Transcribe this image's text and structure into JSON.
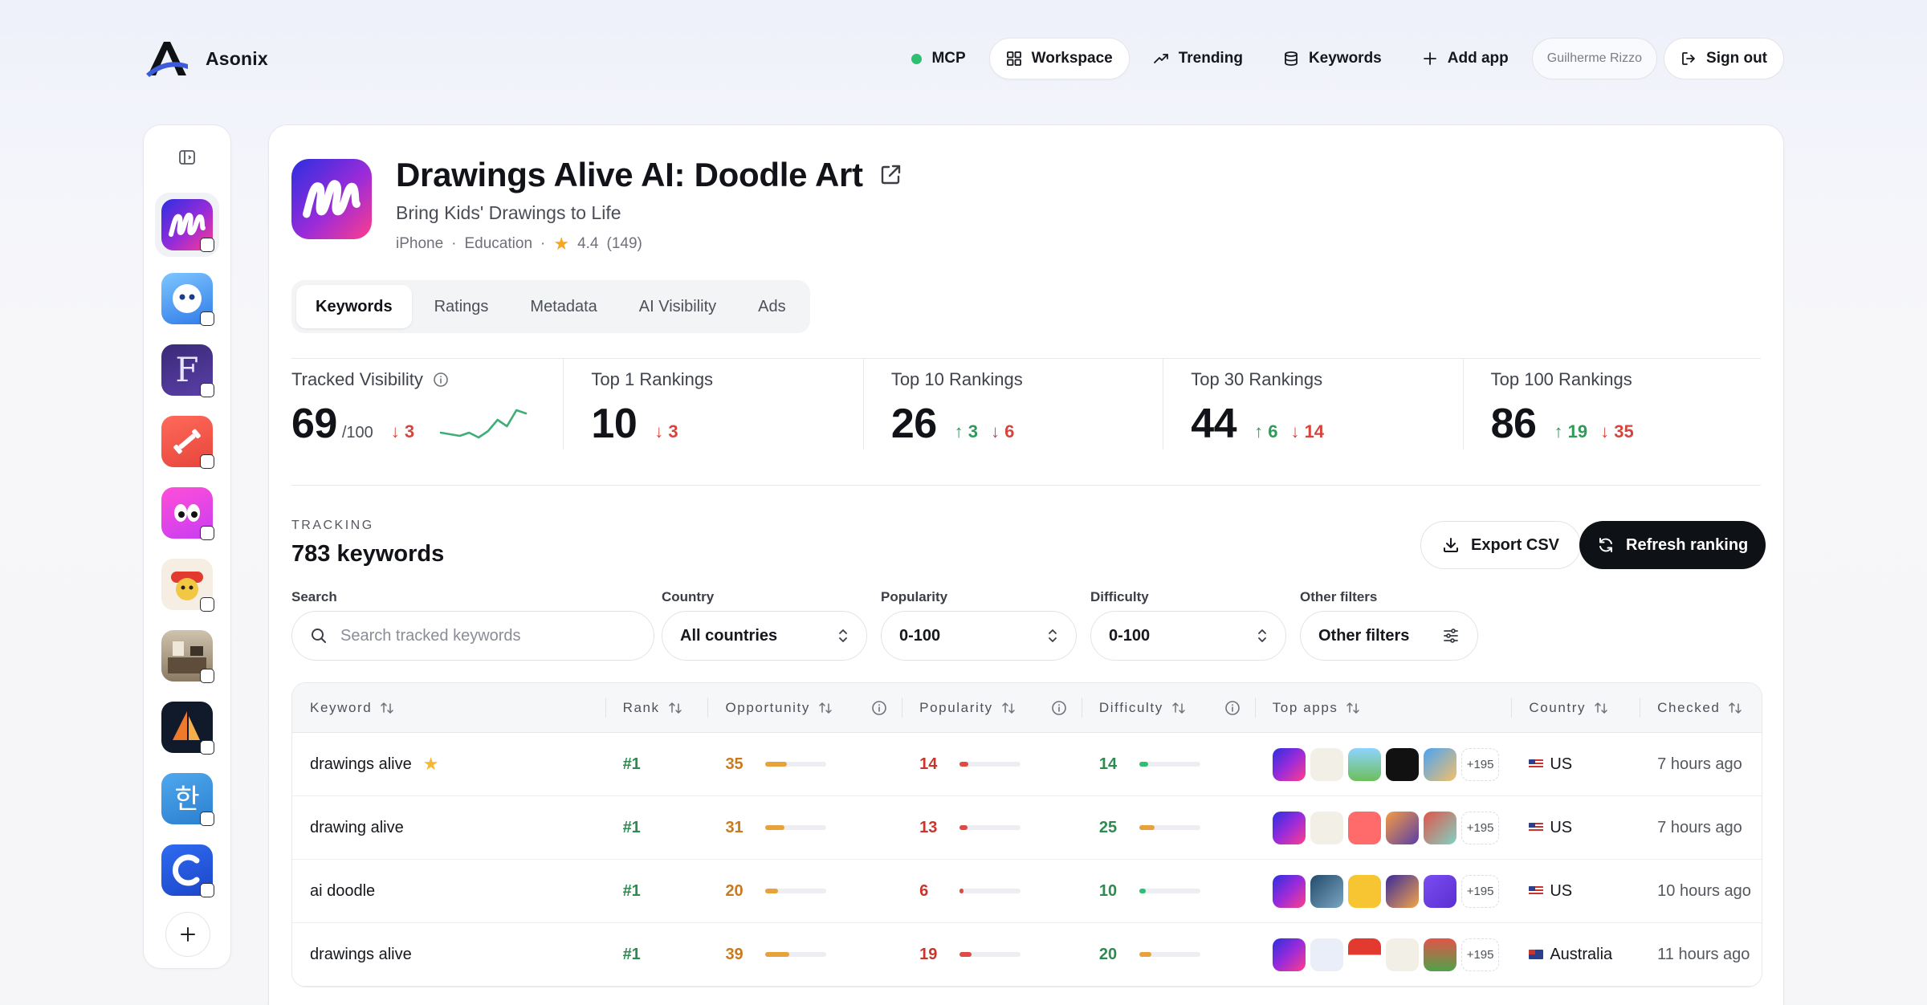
{
  "brand": {
    "name": "Asonix"
  },
  "nav": {
    "mcp": "MCP",
    "workspace": "Workspace",
    "trending": "Trending",
    "keywords": "Keywords",
    "add_app": "Add app",
    "user": "Guilherme Rizzo",
    "sign_out": "Sign out"
  },
  "app": {
    "title": "Drawings Alive AI: Doodle Art",
    "subtitle": "Bring Kids' Drawings to Life",
    "platform": "iPhone",
    "category": "Education",
    "rating": "4.4",
    "rating_count": "(149)"
  },
  "tabs": [
    "Keywords",
    "Ratings",
    "Metadata",
    "AI Visibility",
    "Ads"
  ],
  "stats": {
    "visibility": {
      "label": "Tracked Visibility",
      "value": "69",
      "unit": "/100",
      "delta_down": "3",
      "sparkline": [
        8,
        7,
        6,
        8,
        5,
        9,
        16,
        12,
        22,
        20
      ]
    },
    "top1": {
      "label": "Top 1 Rankings",
      "value": "10",
      "delta_down": "3"
    },
    "top10": {
      "label": "Top 10 Rankings",
      "value": "26",
      "delta_up": "3",
      "delta_down": "6"
    },
    "top30": {
      "label": "Top 30 Rankings",
      "value": "44",
      "delta_up": "6",
      "delta_down": "14"
    },
    "top100": {
      "label": "Top 100 Rankings",
      "value": "86",
      "delta_up": "19",
      "delta_down": "35"
    }
  },
  "tracking": {
    "label": "TRACKING",
    "count": "783 keywords",
    "export_label": "Export CSV",
    "refresh_label": "Refresh ranking"
  },
  "filters": {
    "search_label": "Search",
    "search_placeholder": "Search tracked keywords",
    "country_label": "Country",
    "country_value": "All countries",
    "popularity_label": "Popularity",
    "popularity_value": "0-100",
    "difficulty_label": "Difficulty",
    "difficulty_value": "0-100",
    "other_label": "Other filters",
    "other_value": "Other filters"
  },
  "table": {
    "headers": [
      "Keyword",
      "Rank",
      "Opportunity",
      "Popularity",
      "Difficulty",
      "Top apps",
      "Country",
      "Checked"
    ],
    "rows": [
      {
        "keyword": "drawings alive",
        "starred": true,
        "rank": "#1",
        "opportunity": "35",
        "opportunity_pct": 35,
        "popularity": "14",
        "popularity_pct": 14,
        "difficulty": "14",
        "difficulty_pct": 14,
        "difficulty_color": "#2fbf71",
        "more": "+195",
        "country": "US",
        "checked": "7 hours ago"
      },
      {
        "keyword": "drawing alive",
        "starred": false,
        "rank": "#1",
        "opportunity": "31",
        "opportunity_pct": 31,
        "popularity": "13",
        "popularity_pct": 13,
        "difficulty": "25",
        "difficulty_pct": 25,
        "difficulty_color": "#e8a23a",
        "more": "+195",
        "country": "US",
        "checked": "7 hours ago"
      },
      {
        "keyword": "ai doodle",
        "starred": false,
        "rank": "#1",
        "opportunity": "20",
        "opportunity_pct": 20,
        "popularity": "6",
        "popularity_pct": 6,
        "difficulty": "10",
        "difficulty_pct": 10,
        "difficulty_color": "#2fbf71",
        "more": "+195",
        "country": "US",
        "checked": "10 hours ago"
      },
      {
        "keyword": "drawings alive",
        "starred": false,
        "rank": "#1",
        "opportunity": "39",
        "opportunity_pct": 39,
        "popularity": "19",
        "popularity_pct": 19,
        "difficulty": "20",
        "difficulty_pct": 20,
        "difficulty_color": "#e8a23a",
        "more": "+195",
        "country": "Australia",
        "checked": "11 hours ago"
      }
    ]
  },
  "colors": {
    "accent_dark": "#0e1116",
    "up": "#2f9a5a",
    "down": "#d6453d",
    "opportunity": "#e8a23a",
    "popularity": "#e04a44"
  }
}
